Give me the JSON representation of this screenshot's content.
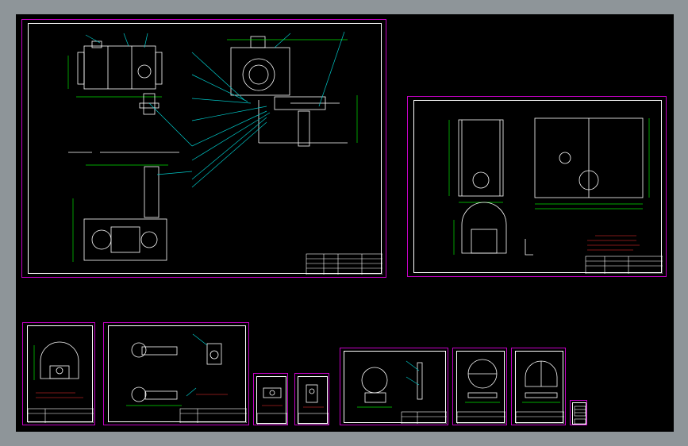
{
  "viewport": {
    "background_color": "#8e9599",
    "canvas_color": "#000000"
  },
  "colors": {
    "sheet_border": "#c400c4",
    "inner_border": "#ffffff",
    "dimension": "#00e000",
    "leader": "#00c8c8",
    "outline": "#ffffff"
  },
  "sheets": [
    {
      "id": "main-assembly",
      "title_block": "",
      "view": "assembly"
    },
    {
      "id": "housing-detail",
      "title_block": "",
      "view": "housing"
    },
    {
      "id": "end-plate-detail",
      "title_block": "",
      "view": "end-plate"
    },
    {
      "id": "bracket-detail",
      "title_block": "",
      "view": "bracket"
    },
    {
      "id": "small-part-a",
      "title_block": "",
      "view": "small-a"
    },
    {
      "id": "small-part-b",
      "title_block": "",
      "view": "small-b"
    },
    {
      "id": "flange-assembly",
      "title_block": "",
      "view": "flange"
    },
    {
      "id": "disk-detail",
      "title_block": "",
      "view": "disk"
    },
    {
      "id": "cap-detail",
      "title_block": "",
      "view": "cap"
    },
    {
      "id": "parts-list",
      "title_block": "",
      "view": "list"
    }
  ]
}
